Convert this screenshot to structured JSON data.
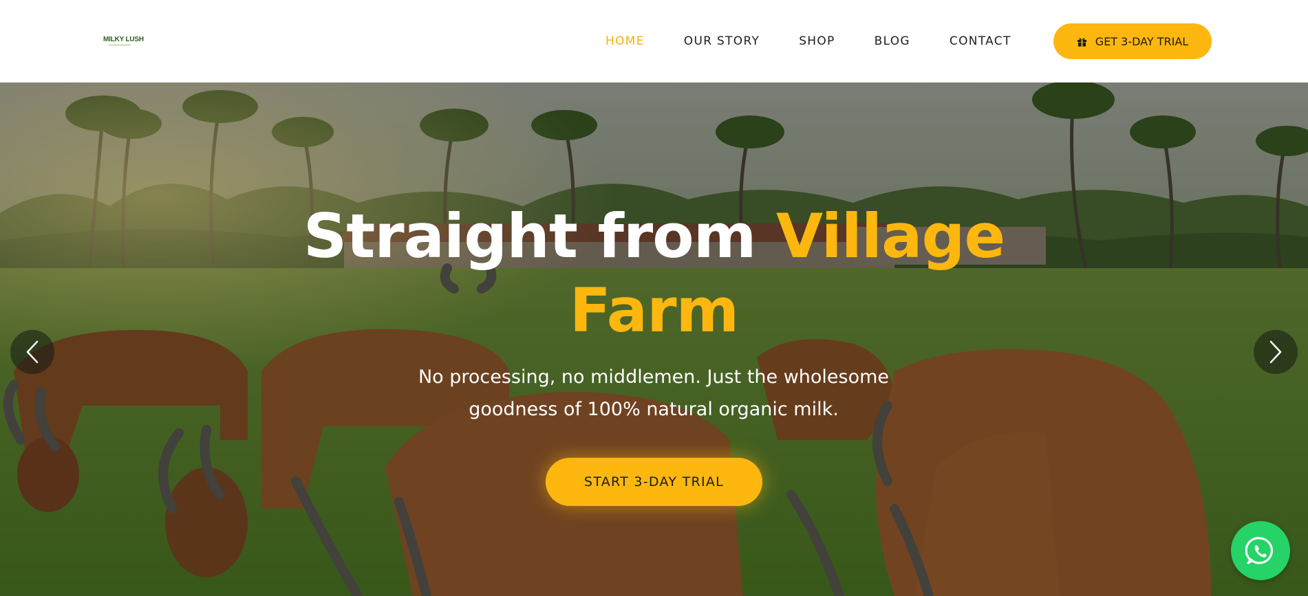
{
  "brand": {
    "logo_text": "MILKY LUSH"
  },
  "nav": {
    "items": [
      {
        "label": "HOME",
        "active": true
      },
      {
        "label": "OUR STORY",
        "active": false
      },
      {
        "label": "SHOP",
        "active": false
      },
      {
        "label": "BLOG",
        "active": false
      },
      {
        "label": "CONTACT",
        "active": false
      }
    ],
    "cta_label": "GET 3-DAY TRIAL",
    "cta_icon": "gift-icon"
  },
  "hero": {
    "title_part1": "Straight from ",
    "title_accent_line1": "Village",
    "title_accent_line2": "Farm",
    "subtitle": "No processing, no middlemen. Just the wholesome goodness of 100% natural organic milk.",
    "cta_label": "START 3-DAY TRIAL",
    "prev_icon": "chevron-left-icon",
    "next_icon": "chevron-right-icon"
  },
  "floating": {
    "icon": "whatsapp-icon"
  },
  "colors": {
    "accent": "#fdb70f",
    "nav_active": "#f6b10d",
    "text_dark": "#1e1e1e",
    "whatsapp": "#25d366"
  }
}
